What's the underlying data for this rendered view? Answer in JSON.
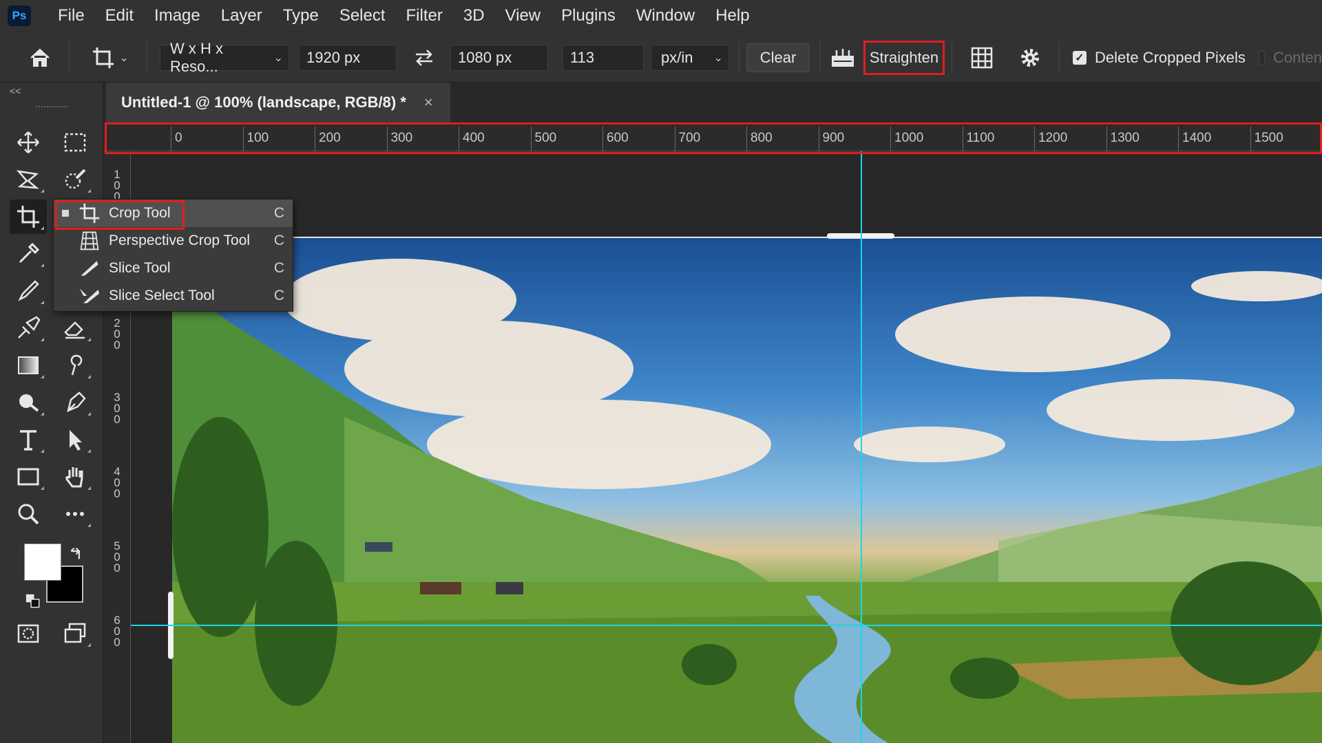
{
  "app": {
    "logo_text": "Ps"
  },
  "menu": [
    "File",
    "Edit",
    "Image",
    "Layer",
    "Type",
    "Select",
    "Filter",
    "3D",
    "View",
    "Plugins",
    "Window",
    "Help"
  ],
  "options": {
    "preset_label": "W x H x Reso...",
    "width_value": "1920 px",
    "height_value": "1080 px",
    "resolution_value": "113",
    "resolution_unit": "px/in",
    "clear_label": "Clear",
    "straighten_label": "Straighten",
    "delete_cropped_label": "Delete Cropped Pixels",
    "delete_cropped_checked": true,
    "content_aware_label": "Conten"
  },
  "toolbar": {
    "collapse_label": "<<",
    "foreground_color": "#ffffff",
    "background_color": "#000000"
  },
  "document": {
    "tab_title": "Untitled-1 @ 100% (landscape, RGB/8) *",
    "close_label": "×"
  },
  "ruler": {
    "h_labels": [
      "0",
      "100",
      "200",
      "300",
      "400",
      "500",
      "600",
      "700",
      "800",
      "900",
      "1000",
      "1100",
      "1200",
      "1300",
      "1400",
      "1500"
    ],
    "v_labels": [
      "100",
      "100",
      "200",
      "300",
      "400",
      "500",
      "600"
    ]
  },
  "flyout": {
    "items": [
      {
        "label": "Crop Tool",
        "shortcut": "C",
        "selected": true
      },
      {
        "label": "Perspective Crop Tool",
        "shortcut": "C",
        "selected": false
      },
      {
        "label": "Slice Tool",
        "shortcut": "C",
        "selected": false
      },
      {
        "label": "Slice Select Tool",
        "shortcut": "C",
        "selected": false
      }
    ]
  },
  "colors": {
    "highlight": "#e01e1e",
    "guide": "#19d6e8"
  }
}
